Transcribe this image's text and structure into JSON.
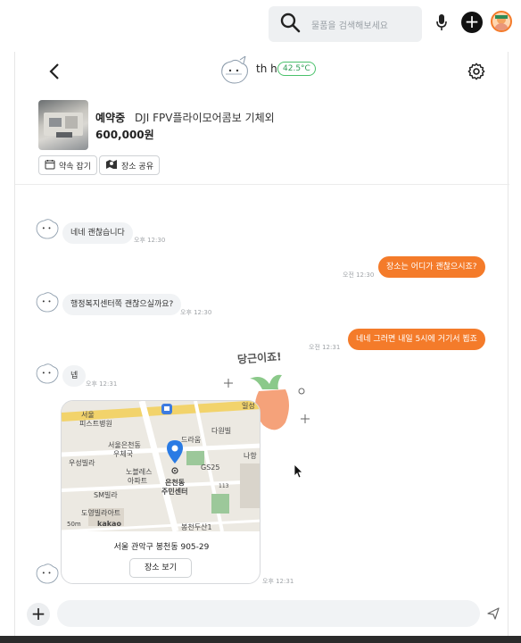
{
  "topbar": {
    "search_placeholder": "물품을 검색해보세요"
  },
  "header": {
    "peer_name": "th h",
    "temperature": "42.5°C"
  },
  "product": {
    "status": "예약중",
    "title": "DJI FPV플라이모어콤보 기체외",
    "price": "600,000원",
    "buttons": [
      "약속 잡기",
      "장소 공유"
    ]
  },
  "messages": [
    {
      "dir": "in",
      "text": "네네 괜찮습니다",
      "time": "오후 12:30"
    },
    {
      "dir": "out",
      "text": "장소는 어디가 괜찮으시죠?",
      "time": "오전 12:30"
    },
    {
      "dir": "in",
      "text": "행정복지센터쪽 괜찮으실까요?",
      "time": "오후 12:30"
    },
    {
      "dir": "out",
      "text": "네네 그러면 내일 5시에 거기서 뵙죠",
      "time": "오전 12:31"
    },
    {
      "dir": "in",
      "text": "넵",
      "time": "오후 12:31"
    }
  ],
  "map": {
    "labels": [
      "서울",
      "피스트병원",
      "서울은천동",
      "우체국",
      "우성빌라",
      "노블레스",
      "아파트",
      "SM빌라",
      "도영빌라아트",
      "은천동",
      "주민센터",
      "다원빌",
      "드라움",
      "GS25",
      "봉천두산1",
      "일성",
      "나항",
      "113"
    ],
    "scale": "50m",
    "brand": "kakao",
    "address": "서울 관악구 봉천동 905-29",
    "view_button": "장소 보기",
    "time": "오후 12:31"
  },
  "sticker": {
    "text": "당근이죠!"
  }
}
